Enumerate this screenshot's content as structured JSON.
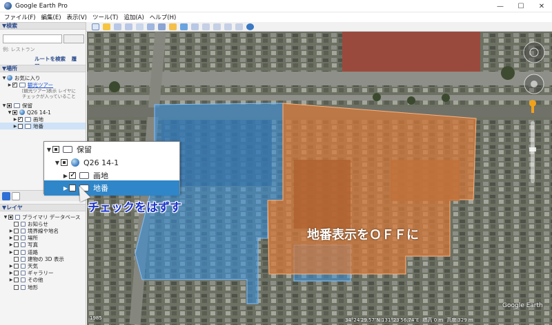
{
  "window": {
    "title": "Google Earth Pro",
    "min": "—",
    "max": "☐",
    "close": "✕"
  },
  "menu": [
    "ファイル(F)",
    "編集(E)",
    "表示(V)",
    "ツール(T)",
    "追加(A)",
    "ヘルプ(H)"
  ],
  "search": {
    "header": "▼検索",
    "placeholder": "",
    "button": "",
    "hint": "例: レストラン",
    "route_link": "ルートを検索",
    "history_link": "履歴"
  },
  "places": {
    "header": "▼場所",
    "favorites": "お気に入り",
    "tour": "観光ツアー",
    "tour_desc_1": "[観光ツアー]表示 レイヤに",
    "tour_desc_2": "チェックが入っていること",
    "saved": "保留",
    "kml": "Q26 14-1",
    "item1": "画地",
    "item2": "地番"
  },
  "layers": {
    "header": "▼レイヤ",
    "items": [
      "プライマリ データベース",
      "お知らせ",
      "境界線や地名",
      "場所",
      "写真",
      "道路",
      "建物の 3D 表示",
      "天気",
      "ギャラリー",
      "その他",
      "地形"
    ]
  },
  "callout": {
    "saved": "保留",
    "kml": "Q26 14-1",
    "item1": "画地",
    "item2": "地番"
  },
  "annotations": {
    "uncheck": "チェックをはずす",
    "off": "地番表示をＯＦＦに"
  },
  "status": {
    "year": "1985",
    "coords": "34°24′29.57″N 131°23′56.74″E",
    "elev": "標高  0 m",
    "alt": "高度  329 m",
    "brand": "Google Earth"
  },
  "colors": {
    "blue_parcel": "#3a8fd9",
    "orange_parcel": "#d97a3a",
    "annotation_blue": "#1a33cc"
  }
}
